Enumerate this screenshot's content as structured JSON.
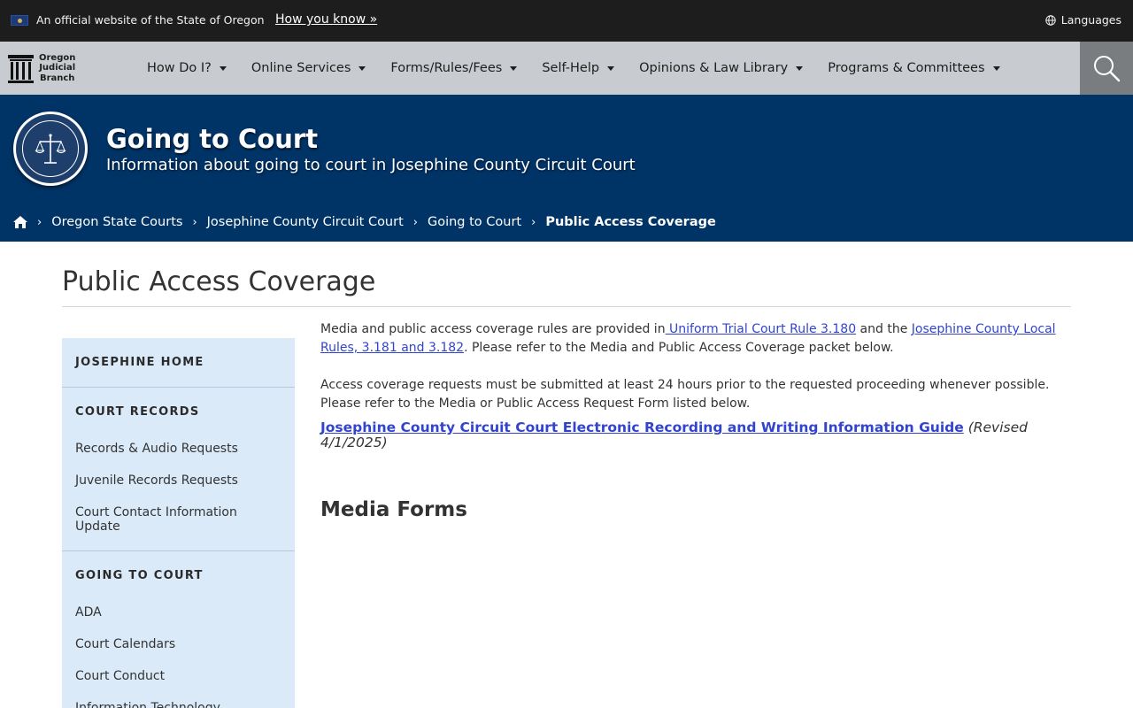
{
  "banner": {
    "official_text": "An official website of the State of Oregon",
    "how_you_know": "How you know »",
    "languages": "Languages"
  },
  "logo": {
    "line1": "Oregon",
    "line2": "Judicial",
    "line3": "Branch"
  },
  "nav": {
    "items": [
      {
        "label": "How Do I?"
      },
      {
        "label": "Online Services"
      },
      {
        "label": "Forms/Rules/Fees"
      },
      {
        "label": "Self-Help"
      },
      {
        "label": "Opinions & Law Library"
      },
      {
        "label": "Programs & Committees"
      }
    ]
  },
  "hero": {
    "title": "Going to Court",
    "subtitle": "Information about going to court in Josephine County Circuit Court"
  },
  "breadcrumb": {
    "items": [
      {
        "label": "Oregon State Courts"
      },
      {
        "label": "Josephine County Circuit Court"
      },
      {
        "label": "Going to Court"
      }
    ],
    "current": "Public Access Coverage"
  },
  "page": {
    "title": "Public Access Coverage"
  },
  "sidebar": {
    "home": "JOSEPHINE HOME",
    "sections": [
      {
        "heading": "COURT RECORDS",
        "links": [
          "Records & Audio Requests",
          "Juvenile Records Requests",
          "Court Contact Information Update"
        ]
      },
      {
        "heading": "GOING TO COURT",
        "links": [
          "ADA",
          "Court Calendars",
          "Court Conduct",
          "Information Technology"
        ]
      }
    ]
  },
  "content": {
    "p1_start": "Media and public access coverage rules are provided in",
    "p1_link1": " Uniform Trial Court Rule 3.180",
    "p1_mid": " and the ",
    "p1_link2": "Josephine County Local Rules, 3.181 and 3.182",
    "p1_end": ". Please refer to the Media and Public Access Coverage packet below.",
    "p2": "Access coverage requests must be submitted at least 24 hours prior to the requested proceeding whenever possible. Please refer to the Media or Public Access Request Form listed below.",
    "guide_link": "Josephine County Circuit Court Electronic Recording and Writing Information Guide",
    "guide_revised": " (Revised 4/1/2025)",
    "media_forms_heading": "Media Forms"
  },
  "colors": {
    "topbar": "#1d1d1d",
    "navbar": "#c8cbcf",
    "hero": "#003366",
    "sidebar": "#daeaf9",
    "link": "#3344cc"
  }
}
